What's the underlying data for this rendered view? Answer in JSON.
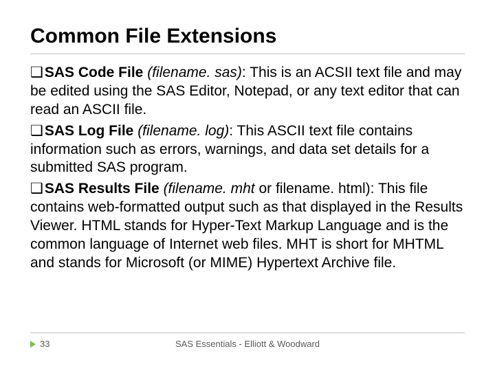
{
  "title": "Common File Extensions",
  "bullets": [
    {
      "marker": "❑",
      "label": "SAS Code File",
      "paren": "(filename. sas)",
      "rest": ": This is an ACSII text file and may be edited using the SAS Editor, Notepad, or any text editor that can read an ASCII file."
    },
    {
      "marker": "❑",
      "label": "SAS Log File",
      "paren": "(filename. log)",
      "rest": ": This ASCII text file contains information such as errors, warnings, and data set details for a submitted SAS program."
    },
    {
      "marker": "❑",
      "label": "SAS Results File",
      "paren": "(filename. mht",
      "paren_tail": " or filename. html): This file contains web-formatted output such as that displayed in the Results Viewer. HTML stands for Hyper-Text Markup Language and is the common language of Internet web files. MHT is short for MHTML and stands for Microsoft (or MIME) Hypertext Archive file."
    }
  ],
  "page_number": "33",
  "footer_text": "SAS Essentials - Elliott & Woodward"
}
